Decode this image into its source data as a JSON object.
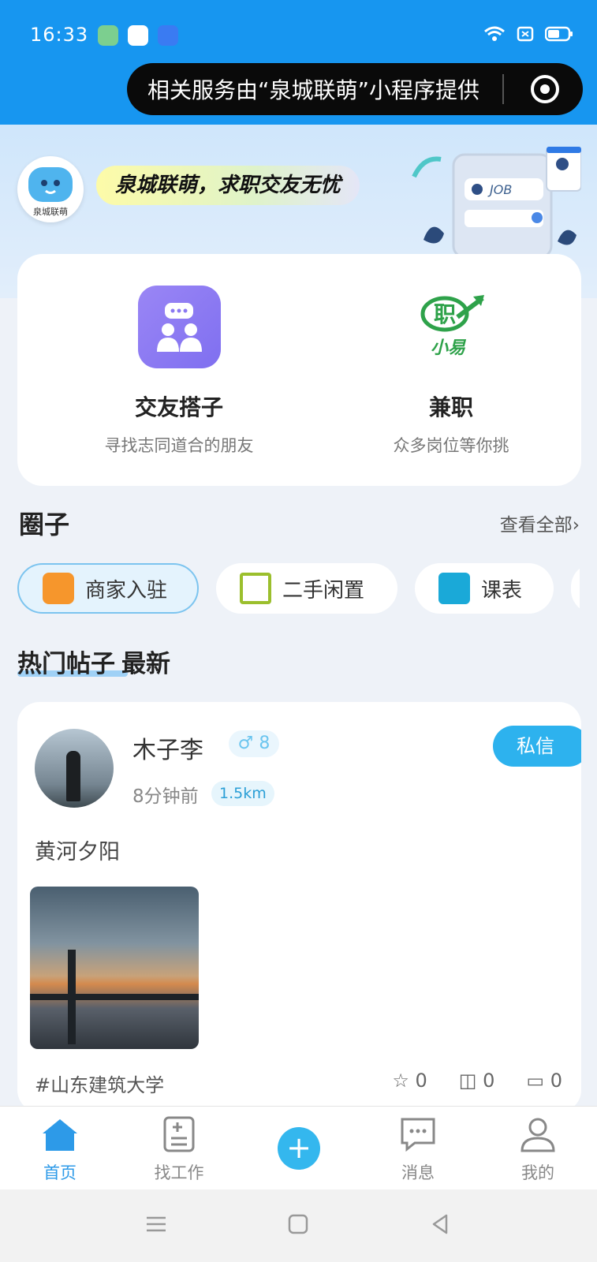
{
  "status_bar": {
    "time": "16:33"
  },
  "miniprogram_capsule": {
    "text": "相关服务由“泉城联萌”小程序提供"
  },
  "banner": {
    "logo_label": "泉城联萌",
    "slogan": "泉城联萌，求职交友无忧",
    "art_label": "JOB"
  },
  "features": [
    {
      "title": "交友搭子",
      "subtitle": "寻找志同道合的朋友"
    },
    {
      "title": "兼职",
      "subtitle": "众多岗位等你挑",
      "icon_text": "职",
      "icon_caption": "小易"
    }
  ],
  "circles": {
    "title": "圈子",
    "see_all": "查看全部›",
    "chips": [
      "商家入驻",
      "二手闲置",
      "课表"
    ]
  },
  "hot": {
    "tabs": [
      "热门帖子",
      "最新"
    ]
  },
  "post": {
    "username": "木子李",
    "gender_badge": "♂ 8",
    "time": "8分钟前",
    "distance": "1.5km",
    "dm_label": "私信",
    "text": "黄河夕阳",
    "tag": "#山东建筑大学",
    "stats": [
      "0",
      "0",
      "0"
    ]
  },
  "tabbar": {
    "items": [
      "首页",
      "找工作",
      "消息",
      "我的"
    ]
  },
  "colors": {
    "primary": "#1796f0",
    "accent": "#2db2ee",
    "active_tab": "#2d9ae8"
  }
}
